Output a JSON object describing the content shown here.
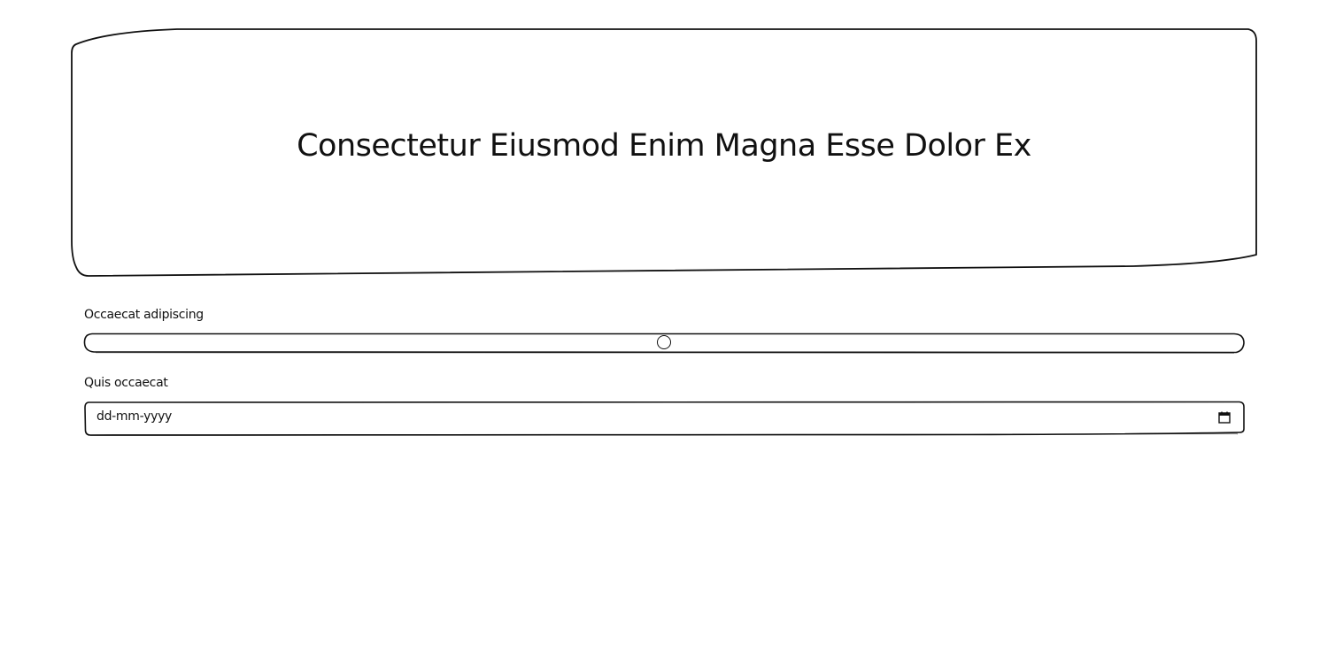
{
  "hero": {
    "title": "Consectetur Eiusmod Enim Magna Esse Dolor Ex"
  },
  "range_field": {
    "label": "Occaecat adipiscing",
    "value_fraction": 0.5
  },
  "date_field": {
    "label": "Quis occaecat",
    "placeholder": "dd-mm-yyyy",
    "icon": "calendar-icon"
  },
  "colors": {
    "stroke": "#111111",
    "background": "#ffffff"
  }
}
